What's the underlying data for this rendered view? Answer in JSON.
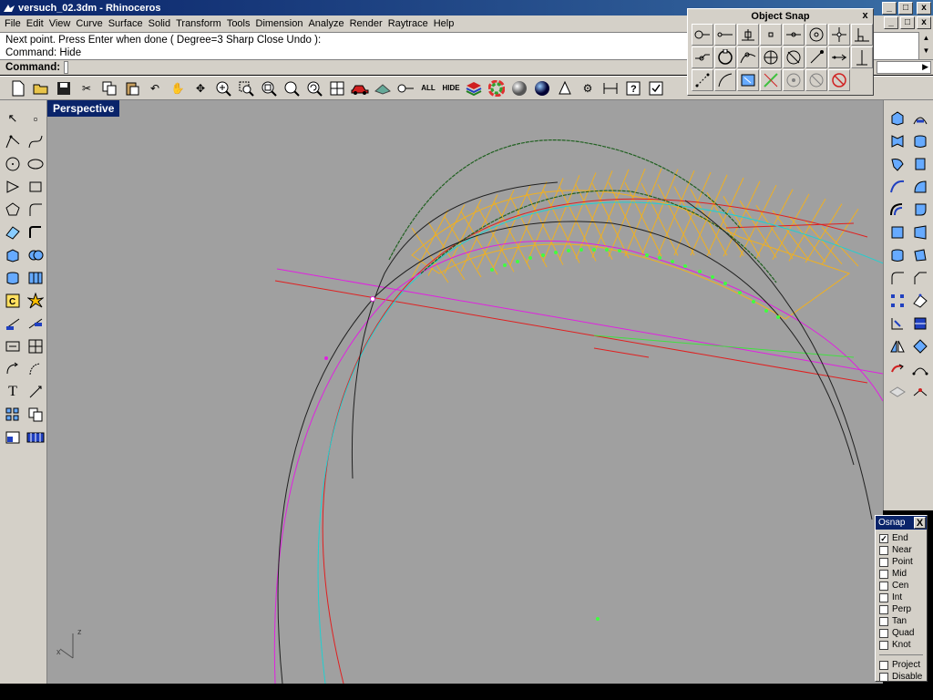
{
  "window": {
    "title": "versuch_02.3dm - Rhinoceros",
    "minimize": "_",
    "maximize": "□",
    "close": "x"
  },
  "menu": [
    "File",
    "Edit",
    "View",
    "Curve",
    "Surface",
    "Solid",
    "Transform",
    "Tools",
    "Dimension",
    "Analyze",
    "Render",
    "Raytrace",
    "Help"
  ],
  "command_history": [
    "Next point. Press Enter when done ( Degree=3 Sharp Close Undo ):",
    "Command: Hide"
  ],
  "command_prompt": "Command:",
  "viewport": {
    "label": "Perspective",
    "axis_z": "z",
    "axis_x": "x"
  },
  "object_snap_palette": {
    "title": "Object Snap",
    "close": "x"
  },
  "osnap": {
    "title": "Osnap",
    "close": "X",
    "items": [
      {
        "label": "End",
        "checked": true
      },
      {
        "label": "Near",
        "checked": false
      },
      {
        "label": "Point",
        "checked": false
      },
      {
        "label": "Mid",
        "checked": false
      },
      {
        "label": "Cen",
        "checked": false
      },
      {
        "label": "Int",
        "checked": false
      },
      {
        "label": "Perp",
        "checked": false
      },
      {
        "label": "Tan",
        "checked": false
      },
      {
        "label": "Quad",
        "checked": false
      },
      {
        "label": "Knot",
        "checked": false
      }
    ],
    "extra": [
      {
        "label": "Project",
        "checked": false
      },
      {
        "label": "Disable",
        "checked": false
      }
    ]
  },
  "toolbar_labels": {
    "all": "ALL",
    "hide": "HIDE"
  }
}
